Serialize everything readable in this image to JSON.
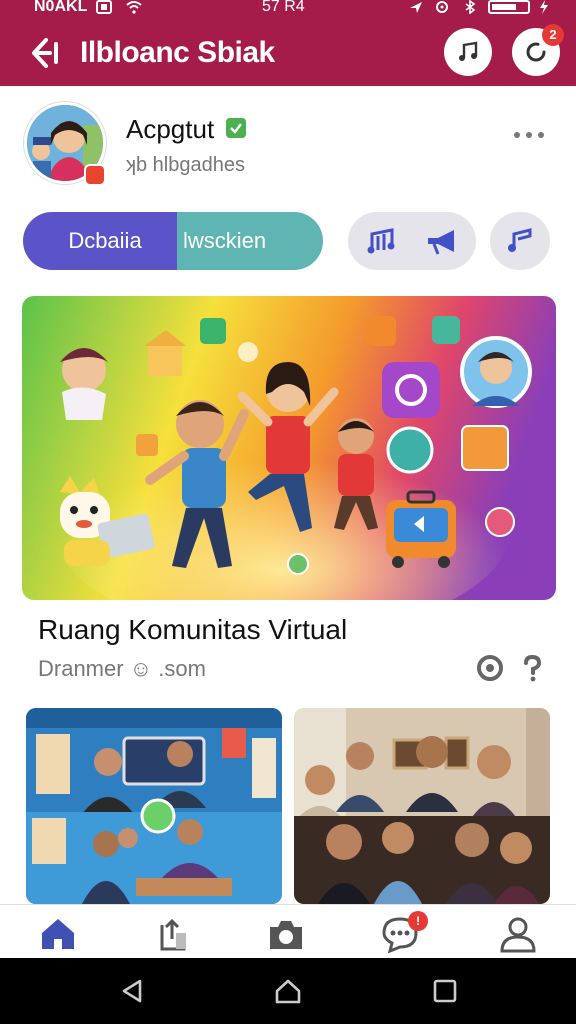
{
  "status_bar": {
    "left": "N0AKL",
    "center": "57 R4"
  },
  "header": {
    "title": "Ilbloanc Sbiak",
    "notification_count": "2"
  },
  "profile": {
    "name": "Acpgtut",
    "subtitle": "ʞb hlbgadhes"
  },
  "tabs": {
    "active": "Dcbaiia",
    "second": "lwsckien"
  },
  "post": {
    "caption": "Ruang Komunitas Virtual",
    "meta": "Dranmer ☺ .som"
  },
  "bottom_nav": {
    "chat_badge": "!"
  },
  "colors": {
    "header": "#a51c4a",
    "pill_active": "#5a54c8",
    "pill_second": "#5fb5b2",
    "nav_active": "#3f51b5"
  },
  "icons": [
    "back-arrow-icon",
    "music-note-icon",
    "refresh-icon",
    "more-dots-icon",
    "music-icon",
    "megaphone-icon",
    "note-icon",
    "home-icon",
    "share-icon",
    "camera-icon",
    "chat-icon",
    "profile-icon"
  ]
}
